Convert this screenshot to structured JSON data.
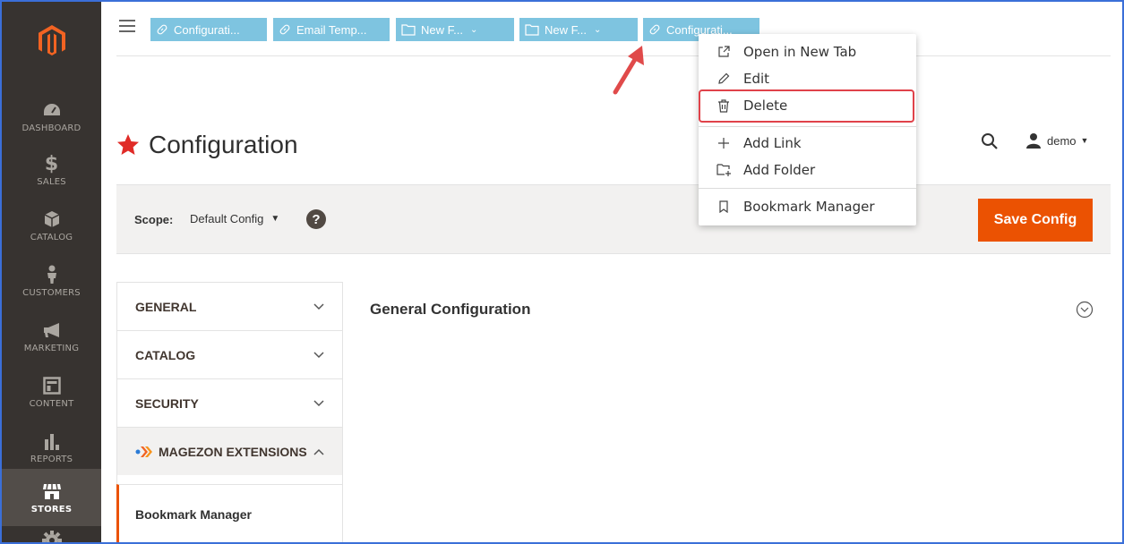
{
  "sidebar": {
    "items": [
      {
        "label": "DASHBOARD",
        "icon": "dashboard-icon"
      },
      {
        "label": "SALES",
        "icon": "dollar-icon"
      },
      {
        "label": "CATALOG",
        "icon": "cube-icon"
      },
      {
        "label": "CUSTOMERS",
        "icon": "person-icon"
      },
      {
        "label": "MARKETING",
        "icon": "megaphone-icon"
      },
      {
        "label": "CONTENT",
        "icon": "layout-icon"
      },
      {
        "label": "REPORTS",
        "icon": "bar-chart-icon"
      },
      {
        "label": "STORES",
        "icon": "store-icon"
      }
    ]
  },
  "toolbar": {
    "buttons": [
      {
        "label": "Configurati...",
        "icon": "link-icon"
      },
      {
        "label": "Email Temp...",
        "icon": "link-icon"
      },
      {
        "label": "New F...",
        "icon": "folder-icon"
      },
      {
        "label": "New F...",
        "icon": "folder-icon"
      },
      {
        "label": "Configurati...",
        "icon": "link-icon"
      }
    ]
  },
  "context_menu": {
    "items": [
      {
        "label": "Open in New Tab",
        "icon": "external-link-icon"
      },
      {
        "label": "Edit",
        "icon": "pencil-icon"
      },
      {
        "label": "Delete",
        "icon": "trash-icon"
      },
      {
        "label": "Add Link",
        "icon": "plus-icon"
      },
      {
        "label": "Add Folder",
        "icon": "add-folder-icon"
      },
      {
        "label": "Bookmark Manager",
        "icon": "bookmark-icon"
      }
    ]
  },
  "page": {
    "title": "Configuration",
    "user": "demo"
  },
  "scope": {
    "label": "Scope:",
    "value": "Default Config",
    "help": "?"
  },
  "save_label": "Save Config",
  "tabs": [
    {
      "label": "GENERAL"
    },
    {
      "label": "CATALOG"
    },
    {
      "label": "SECURITY"
    },
    {
      "label": "MAGEZON EXTENSIONS"
    }
  ],
  "subtab": {
    "label": "Bookmark Manager"
  },
  "section": {
    "title": "General Configuration"
  },
  "colors": {
    "accent": "#eb5202",
    "sidebar": "#373330",
    "toolbar_button": "#7ec4e0",
    "highlight": "#e0424a"
  }
}
